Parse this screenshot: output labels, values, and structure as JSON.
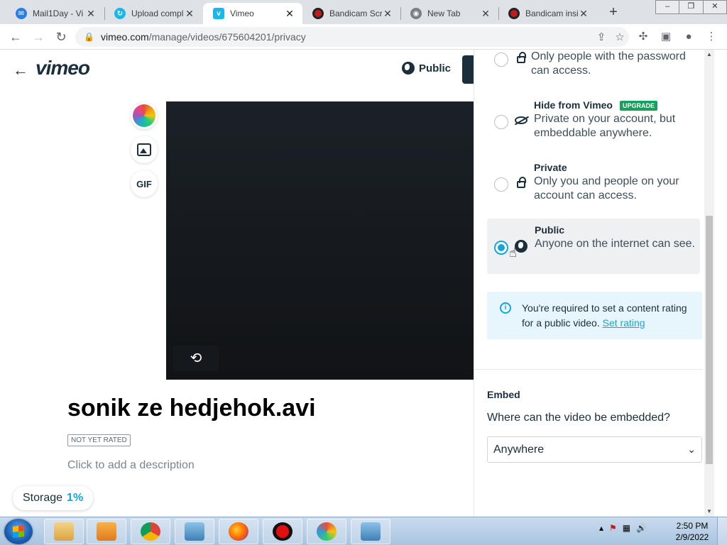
{
  "browser": {
    "tabs": [
      {
        "title": "Mail1Day - Vi",
        "favicon": "mail1day-icon",
        "active": false
      },
      {
        "title": "Upload compl",
        "favicon": "upload-icon",
        "active": false
      },
      {
        "title": "Vimeo",
        "favicon": "vimeo-icon",
        "active": true
      },
      {
        "title": "Bandicam Scr",
        "favicon": "bandicam-icon",
        "active": false
      },
      {
        "title": "New Tab",
        "favicon": "chrome-icon",
        "active": false
      },
      {
        "title": "Bandicam insi",
        "favicon": "bandicam-icon",
        "active": false
      }
    ],
    "url_host": "vimeo.com",
    "url_path": "/manage/videos/675604201/privacy"
  },
  "page": {
    "logo": "vimeo",
    "privacy_button": "Public",
    "tools": {
      "gif_label": "GIF"
    },
    "video_title": "sonik ze hedjehok.avi",
    "rating_badge": "NOT YET RATED",
    "description_placeholder": "Click to add a description",
    "storage_label": "Storage",
    "storage_value": "1%"
  },
  "panel": {
    "options": [
      {
        "title": "",
        "desc": "Only people with the password can access.",
        "icon": "password-lock-icon",
        "selected": false
      },
      {
        "title": "Hide from Vimeo",
        "badge": "UPGRADE",
        "desc": "Private on your account, but embeddable anywhere.",
        "icon": "eye-off-icon",
        "selected": false
      },
      {
        "title": "Private",
        "desc": "Only you and people on your account can access.",
        "icon": "lock-icon",
        "selected": false
      },
      {
        "title": "Public",
        "desc": "Anyone on the internet can see.",
        "icon": "globe-icon",
        "selected": true
      }
    ],
    "info": {
      "text": "You're required to set a content rating for a public video.",
      "link": "Set rating"
    },
    "embed": {
      "label": "Embed",
      "question": "Where can the video be embedded?",
      "selected": "Anywhere"
    }
  },
  "taskbar": {
    "time": "2:50 PM",
    "date": "2/9/2022"
  },
  "colors": {
    "accent": "#17a5d8",
    "text_dark": "#1a2e3b",
    "upgrade_badge": "#1a9e5b",
    "info_bg": "#e6f6fc"
  }
}
